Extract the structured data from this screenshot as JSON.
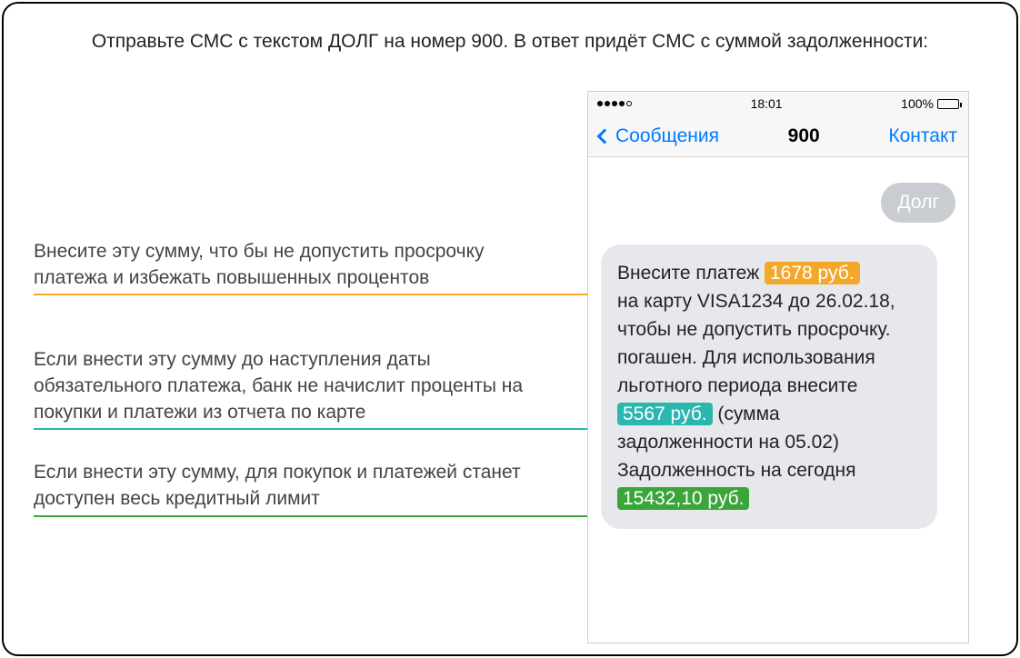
{
  "headline": "Отправьте СМС с текстом ДОЛГ на номер 900. В ответ придёт СМС с суммой задолженности:",
  "annotations": {
    "a1": "Внесите эту сумму, что бы не допустить просрочку платежа и избежать повышенных процентов",
    "a2": "Если внести эту сумму до наступления даты обязательного платежа, банк не начислит проценты на покупки и платежи из отчета по карте",
    "a3": "Если внести эту сумму, для покупок и платежей станет доступен весь кредитный лимит"
  },
  "phone": {
    "status": {
      "time": "18:01",
      "battery": "100%"
    },
    "nav": {
      "back": "Сообщения",
      "title": "900",
      "contact": "Контакт"
    },
    "out_message": "Долг",
    "sms": {
      "p1a": "Внесите платеж ",
      "amount1": "1678 руб.",
      "p1b": "на карту VISA1234 до 26.02.18, чтобы не допустить просрочку.",
      "p2a": "погашен. Для использования льготного периода внесите ",
      "amount2": "5567 руб.",
      "p2b": " (сумма задолженности на 05.02)",
      "p3": "Задолженность на сегодня",
      "amount3": "15432,10 руб."
    }
  },
  "colors": {
    "orange": "#f3a829",
    "teal": "#2bb6af",
    "green": "#3aa63a",
    "ios_blue": "#007aff"
  }
}
